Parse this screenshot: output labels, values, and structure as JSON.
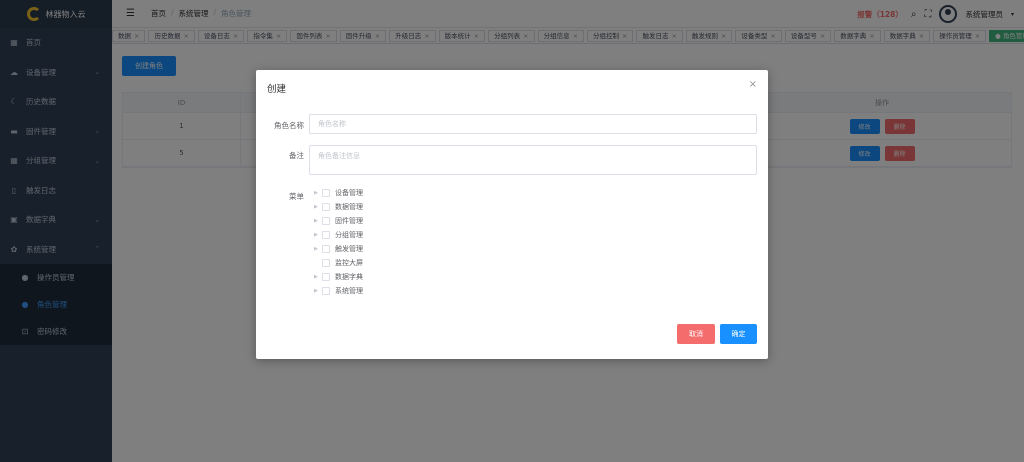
{
  "app": {
    "title": "林器物入云"
  },
  "sidebar": {
    "items": [
      {
        "label": "首页",
        "icon": "dashboard-icon",
        "glyph": "▦",
        "arrow": ""
      },
      {
        "label": "设备管理",
        "icon": "cloud-icon",
        "glyph": "☁",
        "arrow": "⌄"
      },
      {
        "label": "历史数据",
        "icon": "moon-icon",
        "glyph": "☾",
        "arrow": ""
      },
      {
        "label": "固件管理",
        "icon": "chip-icon",
        "glyph": "▬",
        "arrow": "⌄"
      },
      {
        "label": "分组管理",
        "icon": "grid-icon",
        "glyph": "▦",
        "arrow": "⌄"
      },
      {
        "label": "触发日志",
        "icon": "document-icon",
        "glyph": "▯",
        "arrow": ""
      },
      {
        "label": "数据字典",
        "icon": "briefcase-icon",
        "glyph": "▣",
        "arrow": "⌄"
      },
      {
        "label": "系统管理",
        "icon": "gear-icon",
        "glyph": "✿",
        "arrow": "⌃"
      }
    ],
    "submenu": [
      {
        "label": "操作员管理",
        "icon": "user-icon",
        "glyph": "●",
        "active": false
      },
      {
        "label": "角色管理",
        "icon": "users-icon",
        "glyph": "●",
        "active": true
      },
      {
        "label": "密码修改",
        "icon": "lock-icon",
        "glyph": "⊡",
        "active": false
      }
    ]
  },
  "header": {
    "breadcrumb": [
      "首页",
      "系统管理",
      "角色管理"
    ],
    "alarm": "报警（128）",
    "username": "系统管理员"
  },
  "tags": [
    "数据",
    "历史数据",
    "设备日志",
    "指令集",
    "固件列表",
    "固件升级",
    "升级日志",
    "版本统计",
    "分组列表",
    "分组信息",
    "分组控制",
    "触发日志",
    "触发规则",
    "设备类型",
    "设备型号",
    "数据字典",
    "数据字典",
    "操作员管理",
    "● 角色管理"
  ],
  "active_tag": 18,
  "main": {
    "create_button": "创建角色",
    "columns": {
      "id": "ID",
      "ops": "操作"
    },
    "rows": [
      {
        "id": "1",
        "edit": "修改",
        "delete": "删除"
      },
      {
        "id": "5",
        "edit": "修改",
        "delete": "删除"
      }
    ]
  },
  "modal": {
    "title": "创建",
    "close": "×",
    "fields": {
      "name_label": "角色名称",
      "name_placeholder": "角色名称",
      "remark_label": "备注",
      "remark_placeholder": "角色备注信息",
      "menu_label": "菜单"
    },
    "tree": [
      {
        "label": "设备管理",
        "expandable": true
      },
      {
        "label": "数据管理",
        "expandable": true
      },
      {
        "label": "固件管理",
        "expandable": true
      },
      {
        "label": "分组管理",
        "expandable": true
      },
      {
        "label": "触发管理",
        "expandable": true
      },
      {
        "label": "监控大屏",
        "expandable": false
      },
      {
        "label": "数据字典",
        "expandable": true
      },
      {
        "label": "系统管理",
        "expandable": true
      }
    ],
    "cancel": "取消",
    "confirm": "确定"
  },
  "colors": {
    "sidebar": "#304156",
    "primary": "#1890ff",
    "danger": "#f56c6c",
    "tag_active": "#42b983"
  }
}
